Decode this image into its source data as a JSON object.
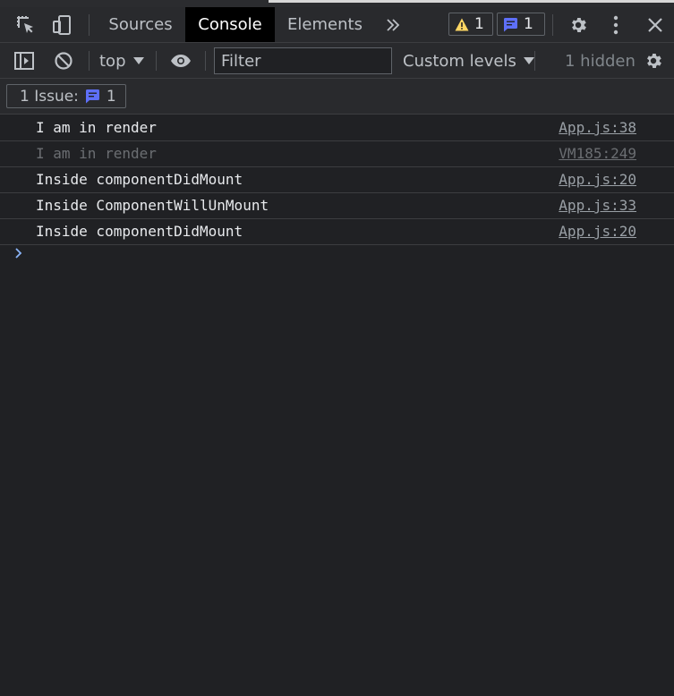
{
  "tabs": [
    {
      "label": "Sources",
      "active": false
    },
    {
      "label": "Console",
      "active": true
    },
    {
      "label": "Elements",
      "active": false
    }
  ],
  "badges": {
    "warnings": "1",
    "messages": "1"
  },
  "toolbar": {
    "context": "top",
    "filter_placeholder": "Filter",
    "levels": "Custom levels",
    "hidden": "1 hidden"
  },
  "issues": {
    "label": "1 Issue:",
    "count": "1"
  },
  "messages": [
    {
      "text": "I am in render",
      "source": "App.js:38",
      "dimmed": false
    },
    {
      "text": "I am in render",
      "source": "VM185:249",
      "dimmed": true
    },
    {
      "text": "Inside componentDidMount",
      "source": "App.js:20",
      "dimmed": false
    },
    {
      "text": "Inside ComponentWillUnMount",
      "source": "App.js:33",
      "dimmed": false
    },
    {
      "text": "Inside componentDidMount",
      "source": "App.js:20",
      "dimmed": false
    }
  ],
  "colors": {
    "background": "#202124",
    "toolbar": "#292a2d",
    "active_tab": "#000000",
    "warning": "#fdd663",
    "info": "#5e6ff8",
    "prompt": "#8ab4f8"
  }
}
